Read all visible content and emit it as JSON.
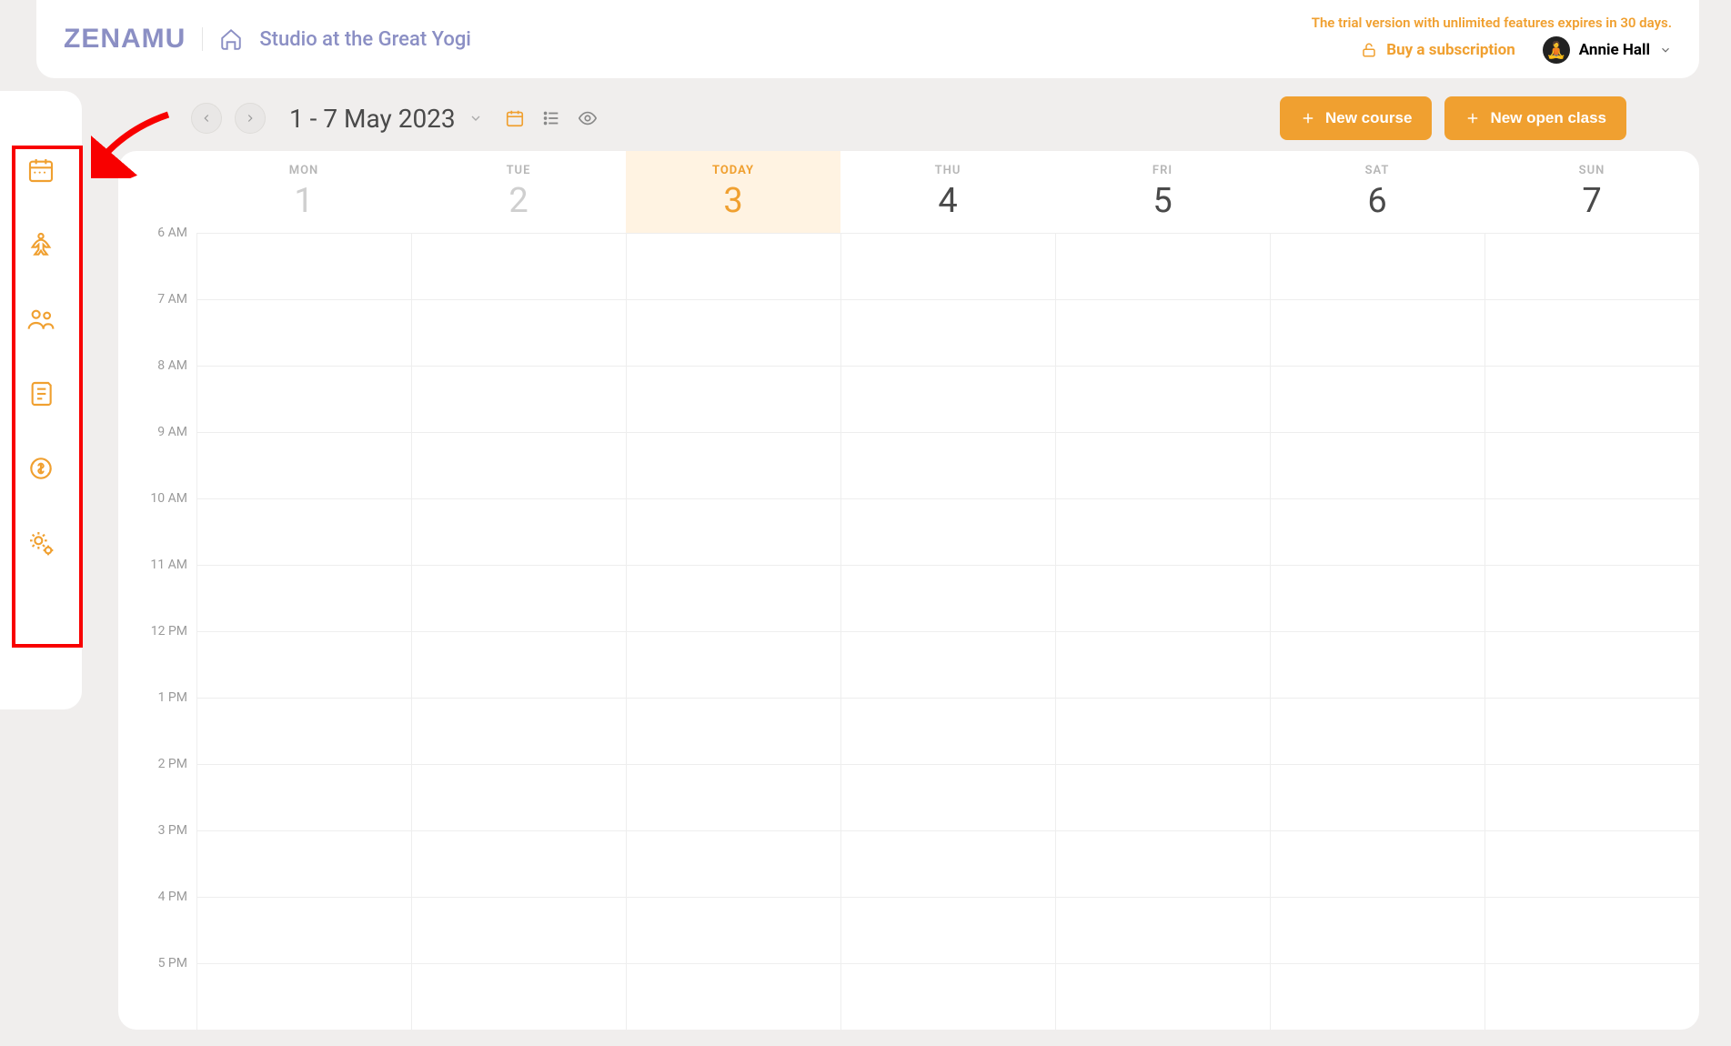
{
  "header": {
    "logo": "ZENAMU",
    "studio_name": "Studio at the Great Yogi",
    "trial_message": "The trial version with unlimited features expires in 30 days.",
    "subscribe_label": "Buy a subscription",
    "user_name": "Annie Hall"
  },
  "toolbar": {
    "date_range": "1 - 7 May 2023",
    "new_course_label": "New course",
    "new_open_class_label": "New open class"
  },
  "calendar": {
    "days": [
      {
        "dow": "MON",
        "num": "1",
        "today": false,
        "muted": true
      },
      {
        "dow": "TUE",
        "num": "2",
        "today": false,
        "muted": true
      },
      {
        "dow": "TODAY",
        "num": "3",
        "today": true,
        "muted": false
      },
      {
        "dow": "THU",
        "num": "4",
        "today": false,
        "muted": false
      },
      {
        "dow": "FRI",
        "num": "5",
        "today": false,
        "muted": false
      },
      {
        "dow": "SAT",
        "num": "6",
        "today": false,
        "muted": false
      },
      {
        "dow": "SUN",
        "num": "7",
        "today": false,
        "muted": false
      }
    ],
    "times": [
      "6 AM",
      "7 AM",
      "8 AM",
      "9 AM",
      "10 AM",
      "11 AM",
      "12 PM",
      "1 PM",
      "2 PM",
      "3 PM",
      "4 PM",
      "5 PM"
    ]
  },
  "sidebar": {
    "items": [
      "calendar",
      "yoga",
      "people",
      "notes",
      "payments",
      "settings"
    ]
  }
}
